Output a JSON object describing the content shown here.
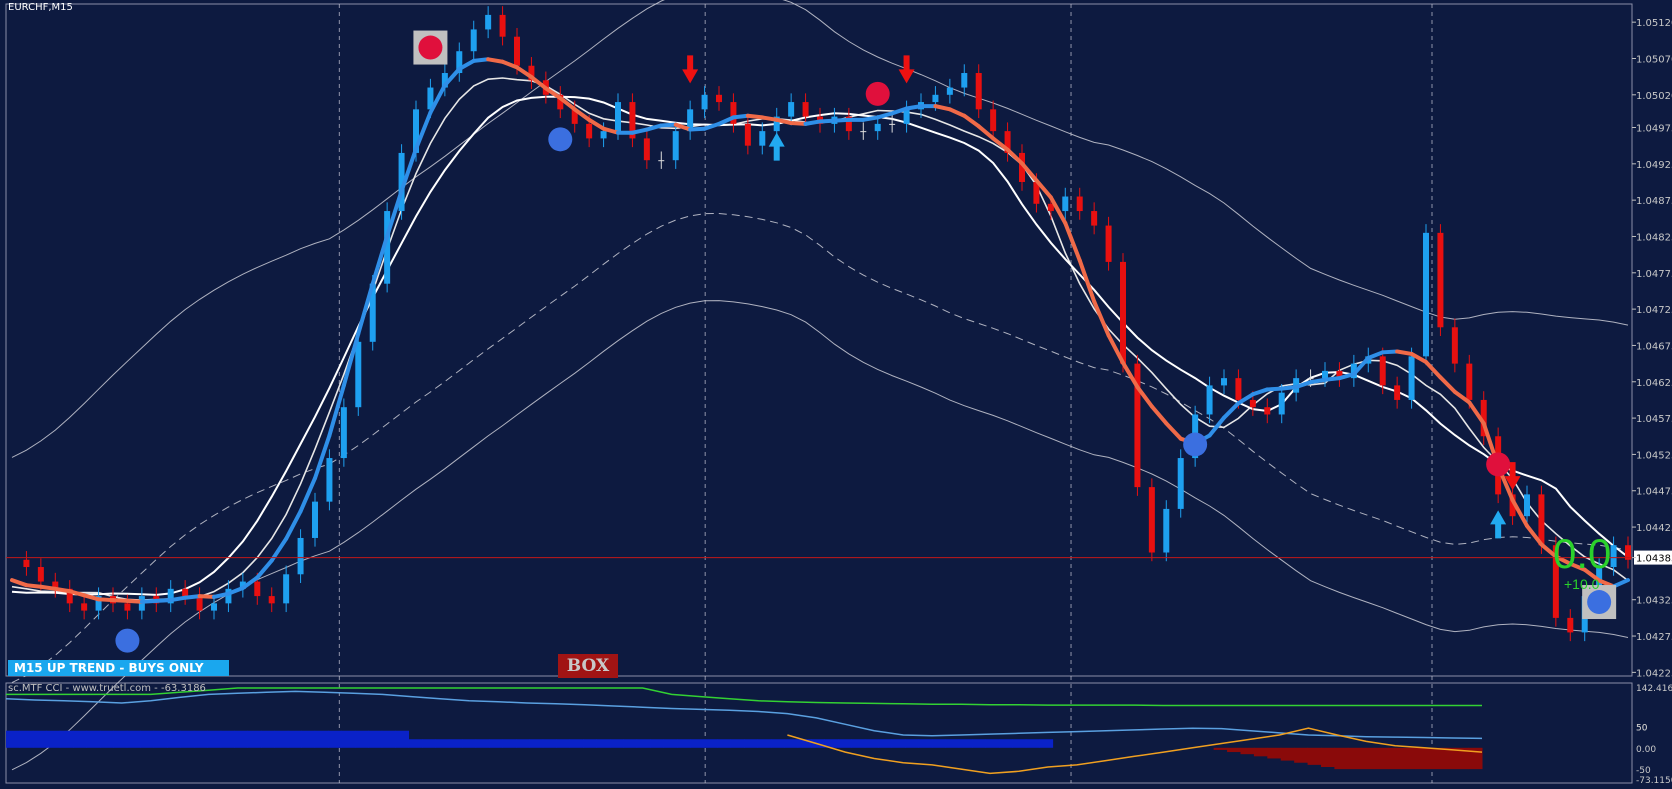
{
  "window": {
    "title": "EURCHF,M15"
  },
  "overlays": {
    "trend_banner": "M15 UP TREND - BUYS ONLY",
    "box_button": "BOX",
    "score_main": "0.0",
    "score_sub": "+10.0"
  },
  "colors": {
    "background": "#0d1a40",
    "bull_candle": "#1ea0f0",
    "bear_candle": "#e81010",
    "neutral_candle": "#dcdcdc",
    "fast_ma_up": "#2f8fe8",
    "fast_ma_down": "#f06a48",
    "signal_down_arrow": "#ee1111",
    "signal_up_arrow": "#22aaf0",
    "score_green": "#2bd12b",
    "cci_histogram_up": "#0a22c8",
    "cci_histogram_down": "#8a0a0a"
  },
  "price_axis": {
    "ticks": [
      "1.05120",
      "1.05070",
      "1.05020",
      "1.04975",
      "1.04925",
      "1.04875",
      "1.04825",
      "1.04775",
      "1.04725",
      "1.04675",
      "1.04625",
      "1.04575",
      "1.04525",
      "1.04475",
      "1.04425",
      "1.04383",
      "1.04325",
      "1.04275",
      "1.04225"
    ],
    "current": "1.04383"
  },
  "cci_axis": {
    "label": "sc.MTF CCI - www.truetl.com - -63.3186",
    "ticks": [
      "142.4166",
      "50",
      "50",
      "0.00",
      "-50",
      "-73.1150"
    ]
  },
  "chart_data": {
    "type": "line",
    "symbol": "EURCHF",
    "timeframe": "M15",
    "ylim": [
      1.0422,
      1.05145
    ],
    "current_price": 1.04383,
    "close_prices": [
      1.0438,
      1.0437,
      1.0435,
      1.0434,
      1.0432,
      1.0431,
      1.0433,
      1.0432,
      1.0431,
      1.0433,
      1.0432,
      1.0434,
      1.0433,
      1.0431,
      1.0432,
      1.0434,
      1.0435,
      1.0433,
      1.0432,
      1.0436,
      1.0441,
      1.0446,
      1.0452,
      1.0459,
      1.0468,
      1.0476,
      1.0486,
      1.0494,
      1.05,
      1.0503,
      1.0505,
      1.0508,
      1.0511,
      1.0513,
      1.051,
      1.0506,
      1.0504,
      1.0502,
      1.05,
      1.0498,
      1.0496,
      1.0497,
      1.0501,
      1.0496,
      1.0493,
      1.0493,
      1.0497,
      1.05,
      1.0502,
      1.0501,
      1.0498,
      1.0495,
      1.0497,
      1.0499,
      1.0501,
      1.0499,
      1.0498,
      1.0499,
      1.0497,
      1.0497,
      1.0498,
      1.0498,
      1.05,
      1.0501,
      1.0502,
      1.0503,
      1.0505,
      1.05,
      1.0497,
      1.0494,
      1.049,
      1.0487,
      1.0486,
      1.0488,
      1.0486,
      1.0484,
      1.0479,
      1.0465,
      1.0448,
      1.0439,
      1.0445,
      1.0452,
      1.0458,
      1.0462,
      1.0463,
      1.046,
      1.0459,
      1.0458,
      1.0461,
      1.0463,
      1.0463,
      1.0464,
      1.0463,
      1.0465,
      1.0466,
      1.0462,
      1.046,
      1.0466,
      1.0483,
      1.047,
      1.0465,
      1.046,
      1.0455,
      1.0447,
      1.0444,
      1.0447,
      1.044,
      1.043,
      1.0428,
      1.0433,
      1.0437,
      1.044,
      1.0438
    ],
    "signals": [
      {
        "type": "sell_arrow",
        "index": 47
      },
      {
        "type": "buy_arrow",
        "index": 53
      },
      {
        "type": "sell_arrow",
        "index": 62
      },
      {
        "type": "buy_arrow",
        "index": 103
      },
      {
        "type": "sell_arrow",
        "index": 104
      },
      {
        "type": "buy_circle",
        "index": 38
      },
      {
        "type": "sell_circle",
        "index": 60
      },
      {
        "type": "buy_circle",
        "index": 82
      },
      {
        "type": "sell_circle",
        "index": 103
      },
      {
        "type": "buy_circle",
        "index": 8
      },
      {
        "type": "sell_badge",
        "index": 29
      },
      {
        "type": "buy_badge",
        "index": 110
      }
    ],
    "cci": {
      "ylim": [
        -73.115,
        142.4166
      ],
      "histogram": [
        40,
        40,
        40,
        40,
        40,
        40,
        40,
        40,
        40,
        40,
        40,
        40,
        40,
        40,
        40,
        40,
        40,
        40,
        40,
        40,
        40,
        40,
        40,
        40,
        40,
        40,
        40,
        40,
        40,
        40,
        20,
        20,
        20,
        20,
        20,
        20,
        20,
        20,
        20,
        20,
        20,
        20,
        20,
        20,
        20,
        20,
        20,
        20,
        20,
        20,
        20,
        20,
        20,
        20,
        20,
        20,
        20,
        20,
        20,
        20,
        20,
        20,
        20,
        20,
        20,
        20,
        20,
        20,
        20,
        20,
        20,
        20,
        20,
        20,
        20,
        20,
        20,
        20,
        0,
        0,
        0,
        0,
        0,
        0,
        0,
        0,
        0,
        0,
        0,
        0,
        -5,
        -10,
        -15,
        -20,
        -25,
        -30,
        -35,
        -40,
        -45,
        -50,
        -50,
        -50,
        -50,
        -50,
        -50,
        -50,
        -50,
        -50,
        -50,
        -50
      ],
      "green_line": [
        125,
        125,
        125,
        125,
        125,
        125,
        130,
        135,
        140,
        140,
        140,
        140,
        140,
        140,
        140,
        140,
        140,
        140,
        140,
        140,
        140,
        140,
        140,
        125,
        120,
        115,
        110,
        108,
        106,
        105,
        104,
        103,
        102,
        102,
        101,
        101,
        100,
        100,
        100,
        100,
        99,
        99,
        99,
        99,
        99,
        99,
        99,
        99,
        99,
        99,
        99,
        99
      ],
      "blue_line": [
        115,
        112,
        110,
        108,
        105,
        110,
        118,
        125,
        128,
        130,
        132,
        130,
        128,
        125,
        120,
        115,
        110,
        108,
        105,
        103,
        101,
        98,
        95,
        92,
        90,
        88,
        85,
        80,
        70,
        55,
        40,
        30,
        28,
        30,
        32,
        34,
        36,
        38,
        40,
        42,
        44,
        46,
        45,
        40,
        35,
        30,
        28,
        26,
        25,
        24,
        23,
        22
      ],
      "orange_line": [
        null,
        null,
        null,
        null,
        null,
        null,
        null,
        null,
        null,
        null,
        null,
        null,
        null,
        null,
        null,
        null,
        null,
        null,
        null,
        null,
        null,
        null,
        null,
        null,
        null,
        null,
        null,
        30,
        10,
        -10,
        -25,
        -35,
        -40,
        -50,
        -60,
        -55,
        -45,
        -40,
        -30,
        -20,
        -10,
        0,
        10,
        20,
        30,
        46,
        30,
        15,
        5,
        0,
        -5,
        -10
      ]
    }
  }
}
